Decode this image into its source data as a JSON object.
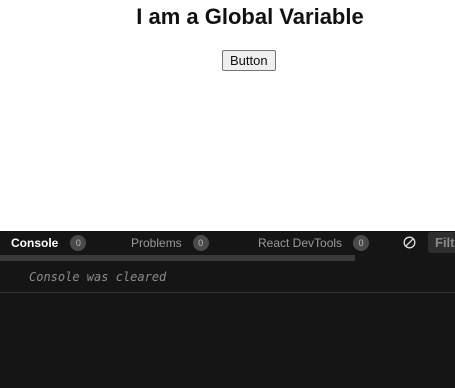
{
  "preview": {
    "heading": "I am a Global Variable",
    "button_label": "Button"
  },
  "devtools": {
    "tabs": [
      {
        "label": "Console",
        "count": "0",
        "active": true
      },
      {
        "label": "Problems",
        "count": "0",
        "active": false
      },
      {
        "label": "React DevTools",
        "count": "0",
        "active": false
      }
    ],
    "clear_icon": "clear-console-icon",
    "filter_placeholder": "Filter",
    "console_messages": [
      "Console was cleared"
    ]
  },
  "colors": {
    "devtools_bg": "#151515",
    "badge_bg": "#4a4a4a",
    "console_text": "#8c8c8c"
  }
}
